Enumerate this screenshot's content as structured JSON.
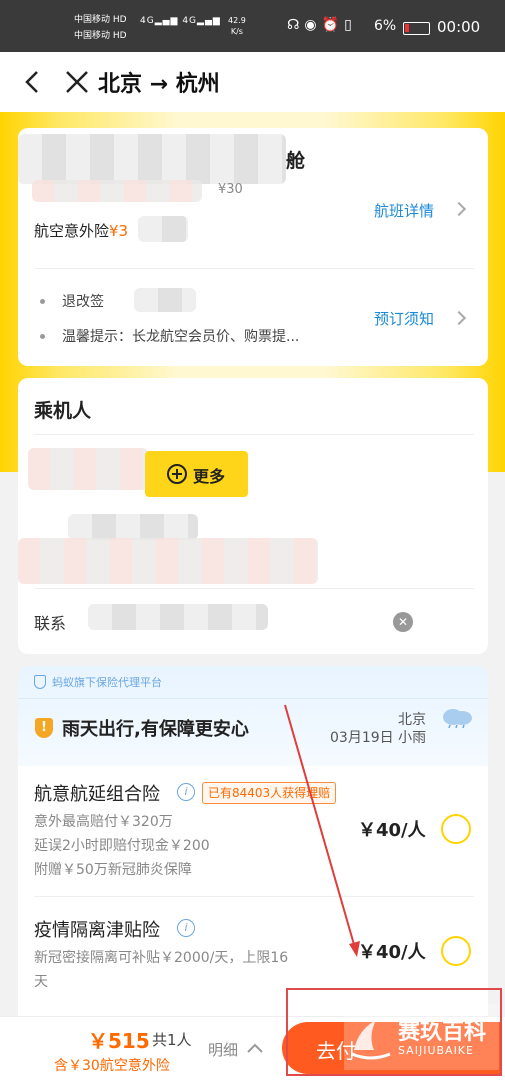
{
  "status_bar": {
    "carrier1": "中国移动",
    "carrier2": "中国移动",
    "hd": "HD",
    "net_speed": "42.9",
    "net_unit": "K/s",
    "battery": "6%",
    "time": "00:00"
  },
  "nav": {
    "title": "北京 → 杭州",
    "icons": [
      "back-icon",
      "close-icon"
    ]
  },
  "flight_card": {
    "cabin_suffix": "舱",
    "price_fragment": "¥30",
    "insurance_label": "航空意外险",
    "insurance_value": "¥3",
    "details_link": "航班详情",
    "bullets": [
      "退改签",
      "温馨提示：长龙航空会员价、购票提..."
    ],
    "notice_link": "预订须知"
  },
  "passenger_card": {
    "title": "乘机人",
    "more_button": "更多",
    "contact_label": "联系"
  },
  "insurance_card": {
    "platform_note": "蚂蚁旗下保险代理平台",
    "headline": "雨天出行,有保障更安心",
    "weather_city": "北京",
    "weather_date": "03月19日 小雨",
    "products": [
      {
        "name": "航意航延组合险",
        "badge": "已有84403人获得理赔",
        "lines": [
          "意外最高赔付￥320万",
          "延误2小时即赔付现金￥200",
          "附赠￥50万新冠肺炎保障"
        ],
        "price": "￥40/人"
      },
      {
        "name": "疫情隔离津贴险",
        "lines": [
          "新冠密接隔离可补贴￥2000/天，上限16",
          "天"
        ],
        "price": "￥40/人"
      }
    ]
  },
  "bottom_bar": {
    "price": "￥515",
    "count": "共1人",
    "note": "含￥30航空意外险",
    "detail": "明细",
    "submit": "去付"
  },
  "watermark": {
    "brand": "赛玖百科",
    "brand_en": "SAIJIUBAIKE"
  },
  "colors": {
    "accent_yellow": "#ffd400",
    "link_blue": "#1b8ad8",
    "price_orange": "#ff6a00",
    "submit": "#ff5a1f"
  }
}
